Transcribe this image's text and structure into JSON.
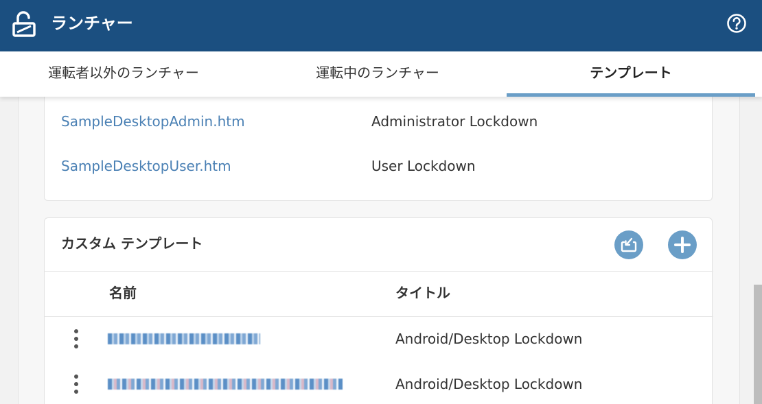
{
  "header": {
    "title": "ランチャー",
    "logo_icon": "unlocked-padlock-icon",
    "help_icon": "help-circle-icon"
  },
  "tabs": [
    {
      "label": "運転者以外のランチャー",
      "active": false
    },
    {
      "label": "運転中のランチャー",
      "active": false
    },
    {
      "label": "テンプレート",
      "active": true
    }
  ],
  "builtin_templates": [
    {
      "name": "SampleDesktopAdmin.htm",
      "title": "Administrator Lockdown"
    },
    {
      "name": "SampleDesktopUser.htm",
      "title": "User Lockdown"
    }
  ],
  "custom_templates": {
    "title": "カスタム テンプレート",
    "import_icon": "import-icon",
    "add_icon": "plus-icon",
    "columns": {
      "name": "名前",
      "title": "タイトル"
    },
    "rows": [
      {
        "name": "",
        "title": "Android/Desktop Lockdown"
      },
      {
        "name": "",
        "title": "Android/Desktop Lockdown"
      }
    ]
  },
  "colors": {
    "header_bg": "#1b4f80",
    "accent": "#6a9ec7",
    "link": "#4a80b4"
  }
}
